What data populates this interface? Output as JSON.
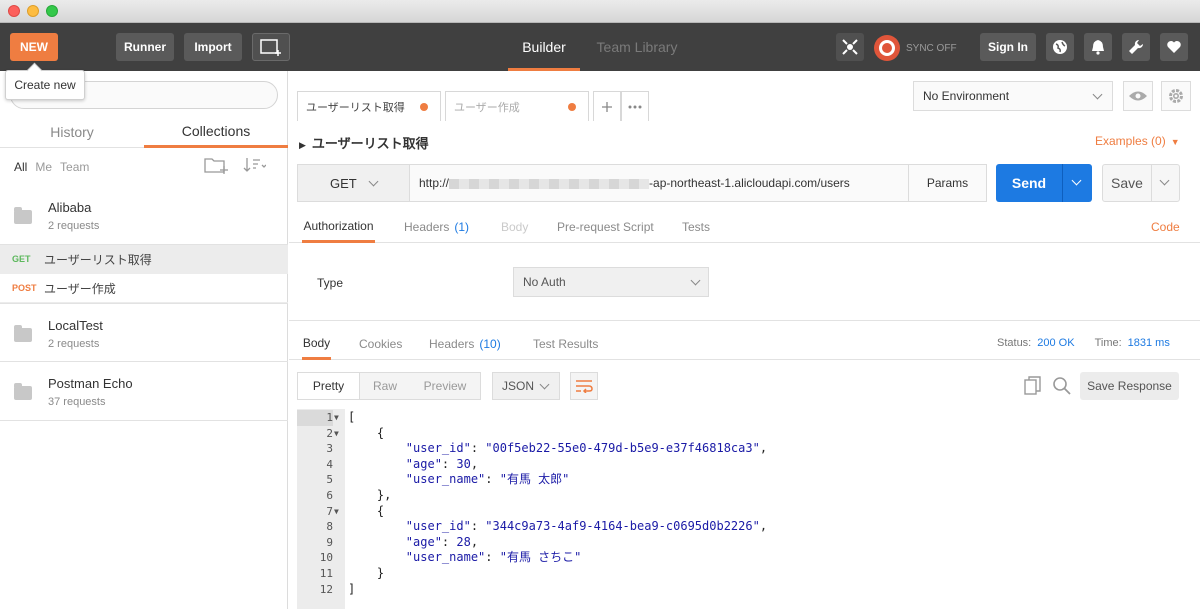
{
  "header": {
    "new_label": "NEW",
    "runner_label": "Runner",
    "import_label": "Import",
    "tabs": [
      "Builder",
      "Team Library"
    ],
    "sync_label": "SYNC OFF",
    "signin_label": "Sign In",
    "tooltip": "Create new"
  },
  "sidebar": {
    "tabs": [
      "History",
      "Collections"
    ],
    "filters": [
      "All",
      "Me",
      "Team"
    ],
    "collections": [
      {
        "name": "Alibaba",
        "count": "2 requests"
      },
      {
        "name": "LocalTest",
        "count": "2 requests"
      },
      {
        "name": "Postman Echo",
        "count": "37 requests"
      }
    ],
    "requests": [
      {
        "method": "GET",
        "name": "ユーザーリスト取得",
        "color": "#5cb85c"
      },
      {
        "method": "POST",
        "name": "ユーザー作成",
        "color": "#ef7d41"
      }
    ]
  },
  "tabs": [
    {
      "label": "ユーザーリスト取得"
    },
    {
      "label": "ユーザー作成"
    }
  ],
  "environment": {
    "selected": "No Environment"
  },
  "request": {
    "title": "ユーザーリスト取得",
    "examples_label": "Examples (0)",
    "method": "GET",
    "url_prefix": "http://",
    "url_suffix": "-ap-northeast-1.alicloudapi.com/users",
    "params_label": "Params",
    "send_label": "Send",
    "save_label": "Save",
    "subtabs": {
      "authorization": "Authorization",
      "headers": "Headers",
      "headers_count": "(1)",
      "body": "Body",
      "prerequest": "Pre-request Script",
      "tests": "Tests"
    },
    "code_label": "Code",
    "auth": {
      "type_label": "Type",
      "type_value": "No Auth"
    }
  },
  "response": {
    "tabs": {
      "body": "Body",
      "cookies": "Cookies",
      "headers": "Headers",
      "headers_count": "(10)",
      "tests": "Test Results"
    },
    "status_label": "Status:",
    "status_value": "200 OK",
    "time_label": "Time:",
    "time_value": "1831 ms",
    "formats": [
      "Pretty",
      "Raw",
      "Preview"
    ],
    "language": "JSON",
    "save_response_label": "Save Response",
    "lines": [
      {
        "n": "1",
        "fold": true,
        "text": "["
      },
      {
        "n": "2",
        "fold": true,
        "text": "    {"
      },
      {
        "n": "3",
        "fold": false,
        "key": "\"user_id\"",
        "val": "\"00f5eb22-55e0-479d-b5e9-e37f46818ca3\"",
        "end": ","
      },
      {
        "n": "4",
        "fold": false,
        "key": "\"age\"",
        "val": "30",
        "end": ","
      },
      {
        "n": "5",
        "fold": false,
        "key": "\"user_name\"",
        "val": "\"有馬 太郎\"",
        "end": ""
      },
      {
        "n": "6",
        "fold": false,
        "text": "    },"
      },
      {
        "n": "7",
        "fold": true,
        "text": "    {"
      },
      {
        "n": "8",
        "fold": false,
        "key": "\"user_id\"",
        "val": "\"344c9a73-4af9-4164-bea9-c0695d0b2226\"",
        "end": ","
      },
      {
        "n": "9",
        "fold": false,
        "key": "\"age\"",
        "val": "28",
        "end": ","
      },
      {
        "n": "10",
        "fold": false,
        "key": "\"user_name\"",
        "val": "\"有馬 さちこ\"",
        "end": ""
      },
      {
        "n": "11",
        "fold": false,
        "text": "    }"
      },
      {
        "n": "12",
        "fold": false,
        "text": "]"
      }
    ]
  }
}
